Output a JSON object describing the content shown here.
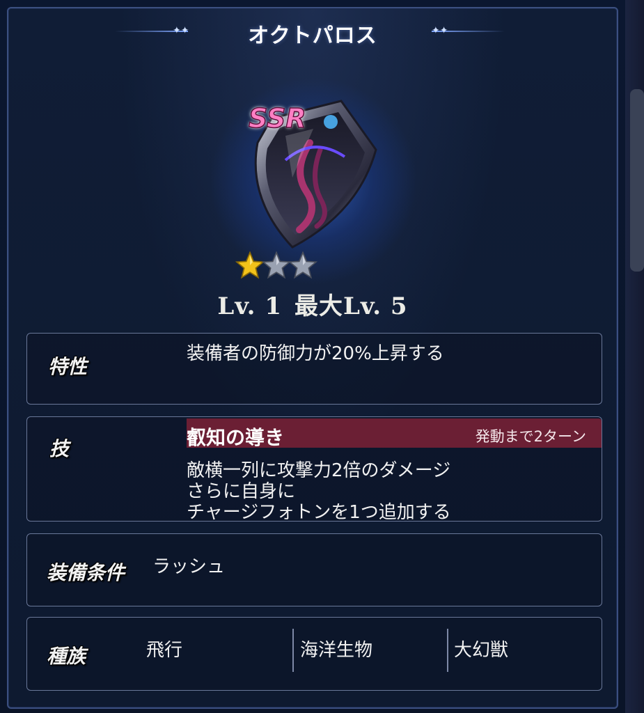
{
  "window": {
    "title": "オクトパロス"
  },
  "item": {
    "rarity": "SSR",
    "stars_filled": 1,
    "stars_total": 3,
    "icon": "shield-icon"
  },
  "level": {
    "current": "Lv. 1",
    "max": "最大Lv. 5"
  },
  "trait": {
    "label": "特性",
    "text": "装備者の防御力が20%上昇する"
  },
  "skill": {
    "label": "技",
    "name": "叡知の導き",
    "cooldown": "発動まで2ターン",
    "lines": [
      "敵横一列に攻撃力2倍のダメージ",
      "さらに自身に",
      "チャージフォトンを1つ追加する"
    ]
  },
  "equip": {
    "label": "装備条件",
    "value": "ラッシュ"
  },
  "race": {
    "label": "種族",
    "values": [
      "飛行",
      "海洋生物",
      "大幻獣"
    ]
  },
  "colors": {
    "skill_bar": "#6b1f34",
    "rarity": "#ff7fc4",
    "star_gold": "#f2c21a",
    "star_silver": "#9aa2b2"
  }
}
